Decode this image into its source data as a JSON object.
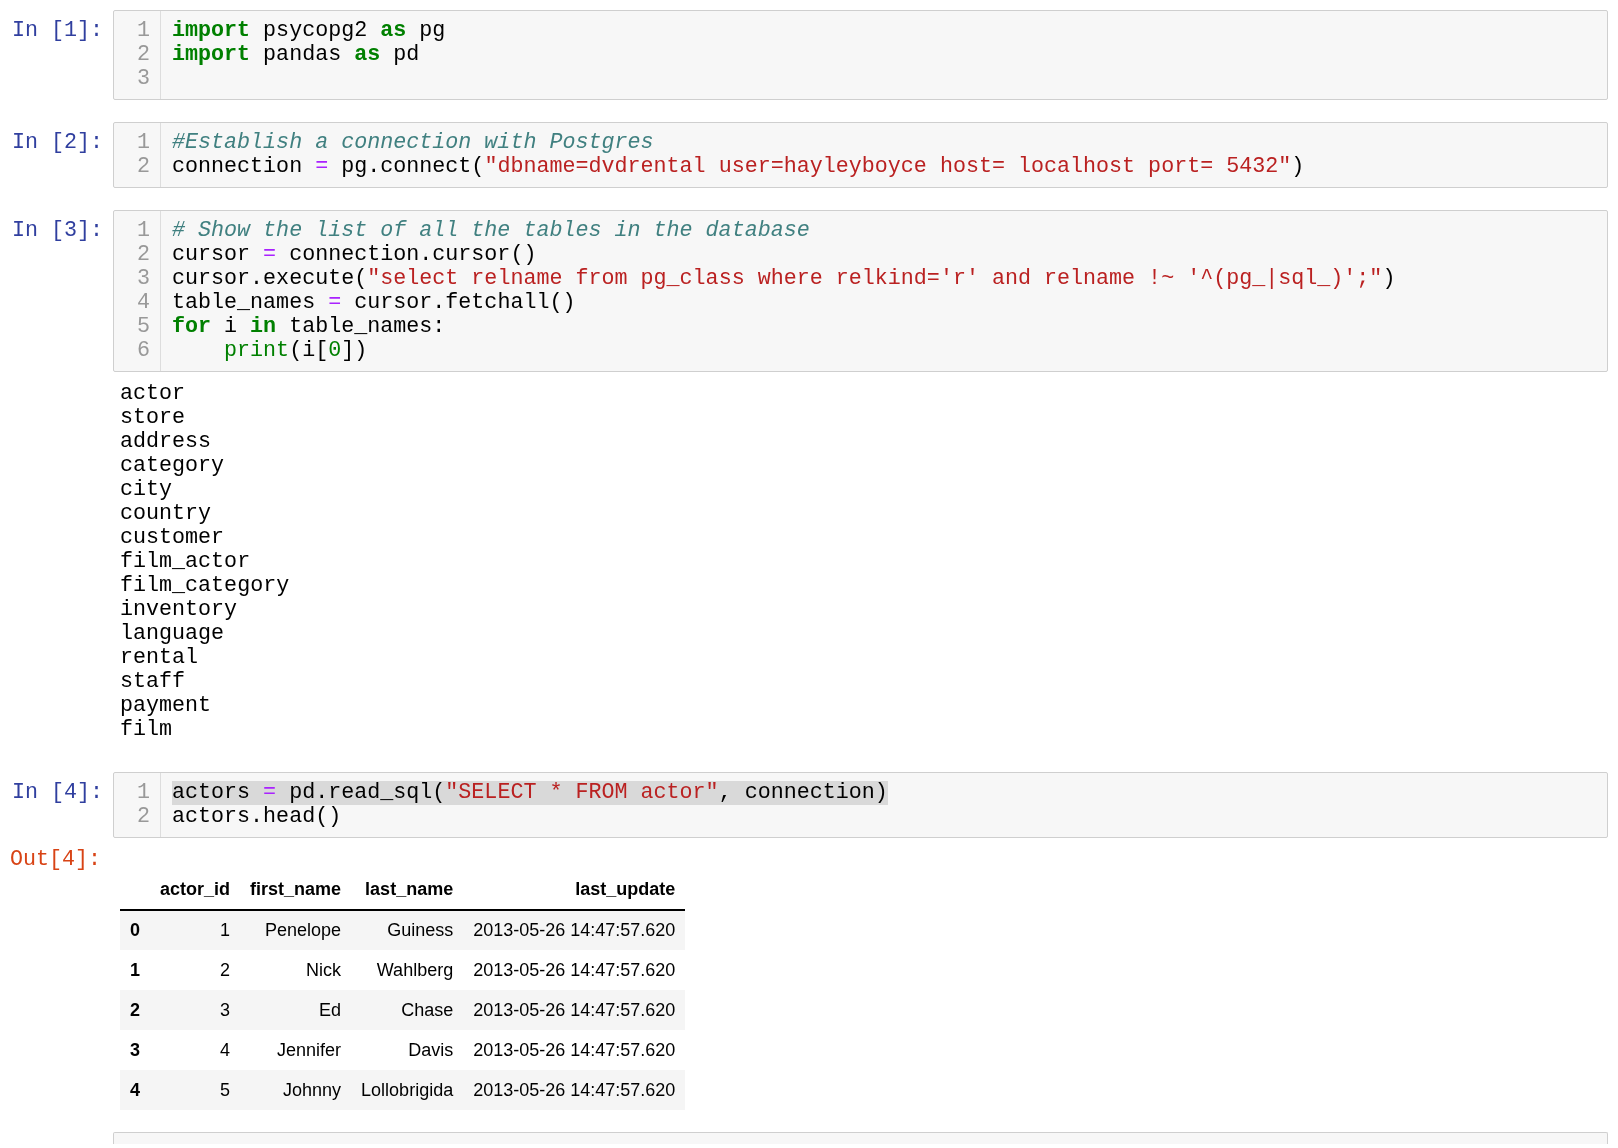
{
  "cells": [
    {
      "kind": "code",
      "prompt": "In [1]:",
      "lines": [
        {
          "number": "1",
          "highlighted": false,
          "tokens": [
            {
              "kind": "keyword",
              "text": "import"
            },
            {
              "kind": "plain",
              "text": " psycopg2 "
            },
            {
              "kind": "keyword",
              "text": "as"
            },
            {
              "kind": "plain",
              "text": " pg"
            }
          ]
        },
        {
          "number": "2",
          "highlighted": false,
          "tokens": [
            {
              "kind": "keyword",
              "text": "import"
            },
            {
              "kind": "plain",
              "text": " pandas "
            },
            {
              "kind": "keyword",
              "text": "as"
            },
            {
              "kind": "plain",
              "text": " pd"
            }
          ]
        },
        {
          "number": "3",
          "highlighted": false
        }
      ]
    },
    {
      "kind": "code",
      "prompt": "In [2]:",
      "lines": [
        {
          "number": "1",
          "highlighted": false,
          "tokens": [
            {
              "kind": "comment",
              "text": "#Establish a connection with Postgres"
            }
          ]
        },
        {
          "number": "2",
          "highlighted": false,
          "tokens": [
            {
              "kind": "plain",
              "text": "connection "
            },
            {
              "kind": "operator",
              "text": "="
            },
            {
              "kind": "plain",
              "text": " pg.connect("
            },
            {
              "kind": "string",
              "text": "\"dbname=dvdrental user=hayleyboyce host= localhost port= 5432\""
            },
            {
              "kind": "plain",
              "text": ")"
            }
          ]
        }
      ]
    },
    {
      "kind": "code",
      "prompt": "In [3]:",
      "lines": [
        {
          "number": "1",
          "highlighted": false,
          "tokens": [
            {
              "kind": "comment",
              "text": "# Show the list of all the tables in the database"
            }
          ]
        },
        {
          "number": "2",
          "highlighted": false,
          "tokens": [
            {
              "kind": "plain",
              "text": "cursor "
            },
            {
              "kind": "operator",
              "text": "="
            },
            {
              "kind": "plain",
              "text": " connection.cursor()"
            }
          ]
        },
        {
          "number": "3",
          "highlighted": false,
          "tokens": [
            {
              "kind": "plain",
              "text": "cursor.execute("
            },
            {
              "kind": "string",
              "text": "\"select relname from pg_class where relkind='r' and relname !~ '^(pg_|sql_)';\""
            },
            {
              "kind": "plain",
              "text": ")"
            }
          ]
        },
        {
          "number": "4",
          "highlighted": false,
          "tokens": [
            {
              "kind": "plain",
              "text": "table_names "
            },
            {
              "kind": "operator",
              "text": "="
            },
            {
              "kind": "plain",
              "text": " cursor.fetchall()"
            }
          ]
        },
        {
          "number": "5",
          "highlighted": false,
          "tokens": [
            {
              "kind": "keyword",
              "text": "for"
            },
            {
              "kind": "plain",
              "text": " i "
            },
            {
              "kind": "keyword",
              "text": "in"
            },
            {
              "kind": "plain",
              "text": " table_names:"
            }
          ]
        },
        {
          "number": "6",
          "highlighted": false,
          "tokens": [
            {
              "kind": "builtin",
              "text": "    print"
            },
            {
              "kind": "plain",
              "text": "(i["
            },
            {
              "kind": "number",
              "text": "0"
            },
            {
              "kind": "plain",
              "text": "])"
            }
          ]
        }
      ],
      "output": {
        "kind": "stream",
        "lines": [
          "actor",
          "store",
          "address",
          "category",
          "city",
          "country",
          "customer",
          "film_actor",
          "film_category",
          "inventory",
          "language",
          "rental",
          "staff",
          "payment",
          "film"
        ]
      }
    },
    {
      "kind": "code",
      "prompt": "In [4]:",
      "lines": [
        {
          "number": "1",
          "highlighted": true,
          "tokens": [
            {
              "kind": "plain",
              "text": "actors "
            },
            {
              "kind": "operator",
              "text": "="
            },
            {
              "kind": "plain",
              "text": " pd.read_sql("
            },
            {
              "kind": "string",
              "text": "\"SELECT * FROM actor\""
            },
            {
              "kind": "plain",
              "text": ", connection)"
            }
          ]
        },
        {
          "number": "2",
          "highlighted": false,
          "tokens": [
            {
              "kind": "plain",
              "text": "actors.head()"
            }
          ]
        }
      ],
      "output": {
        "kind": "table",
        "prompt": "Out[4]:",
        "columns": [
          "actor_id",
          "first_name",
          "last_name",
          "last_update"
        ],
        "rows": [
          {
            "index": "0",
            "cells": [
              "1",
              "Penelope",
              "Guiness",
              "2013-05-26 14:47:57.620"
            ]
          },
          {
            "index": "1",
            "cells": [
              "2",
              "Nick",
              "Wahlberg",
              "2013-05-26 14:47:57.620"
            ]
          },
          {
            "index": "2",
            "cells": [
              "3",
              "Ed",
              "Chase",
              "2013-05-26 14:47:57.620"
            ]
          },
          {
            "index": "3",
            "cells": [
              "4",
              "Jennifer",
              "Davis",
              "2013-05-26 14:47:57.620"
            ]
          },
          {
            "index": "4",
            "cells": [
              "5",
              "Johnny",
              "Lollobrigida",
              "2013-05-26 14:47:57.620"
            ]
          }
        ]
      }
    },
    {
      "kind": "code"
    }
  ]
}
